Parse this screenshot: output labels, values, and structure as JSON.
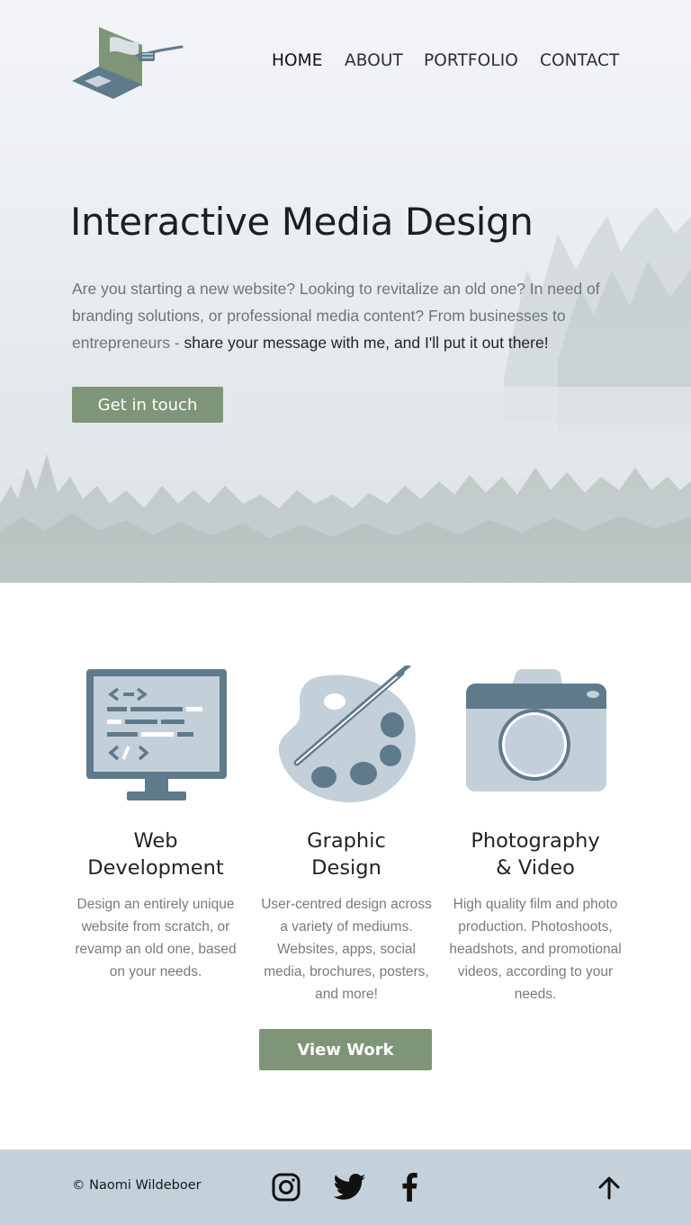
{
  "nav": {
    "items": [
      {
        "label": "HOME",
        "active": true
      },
      {
        "label": "ABOUT",
        "active": false
      },
      {
        "label": "PORTFOLIO",
        "active": false
      },
      {
        "label": "CONTACT",
        "active": false
      }
    ]
  },
  "hero": {
    "title": "Interactive Media Design",
    "text_intro": "Are you starting a new website? Looking to revitalize an old one? In need of branding solutions, or professional media content? From businesses to entrepreneurs - ",
    "text_emphasis": "share your message with me, and I'll put it out there!",
    "cta_label": "Get in touch"
  },
  "services": [
    {
      "icon": "monitor-code-icon",
      "title_line1": "Web",
      "title_line2": "Development",
      "description": "Design an entirely unique website from scratch, or revamp an old one, based on your needs."
    },
    {
      "icon": "palette-brush-icon",
      "title_line1": "Graphic",
      "title_line2": "Design",
      "description": "User-centred design across a variety of mediums. Websites, apps, social media, brochures, posters, and more!"
    },
    {
      "icon": "camera-icon",
      "title_line1": "Photography",
      "title_line2": "& Video",
      "description": "High quality film and photo production. Photoshoots, headshots, and promotional videos, according to your needs."
    }
  ],
  "view_work_label": "View Work",
  "footer": {
    "copyright": "© Naomi Wildeboer",
    "social": [
      "instagram-icon",
      "twitter-icon",
      "facebook-icon"
    ],
    "back_to_top_icon": "arrow-up-icon"
  },
  "colors": {
    "accent_green": "#7f9577",
    "icon_slate": "#5f7a8a",
    "icon_light": "#bfcdd8",
    "footer_bg": "#c5d1da"
  }
}
